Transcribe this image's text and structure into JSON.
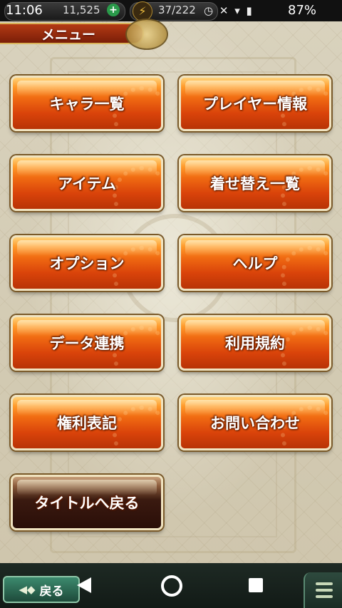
{
  "statusbar": {
    "time": "11:06",
    "coins": "11,525",
    "plus": "+",
    "energy": "37/222",
    "icons": "⚡ ◷ ✕ ▾",
    "battery": "87%"
  },
  "header": {
    "title": "メニュー"
  },
  "buttons": [
    "キャラ一覧",
    "プレイヤー情報",
    "アイテム",
    "着せ替え一覧",
    "オプション",
    "ヘルプ",
    "データ連携",
    "利用規約",
    "権利表記",
    "お問い合わせ",
    "タイトルへ戻る"
  ],
  "bottombar": {
    "back_label": "戻る"
  },
  "colors": {
    "button_orange": "#f06a12",
    "button_dark": "#2a0e08",
    "back_green": "#3c8a6e"
  }
}
